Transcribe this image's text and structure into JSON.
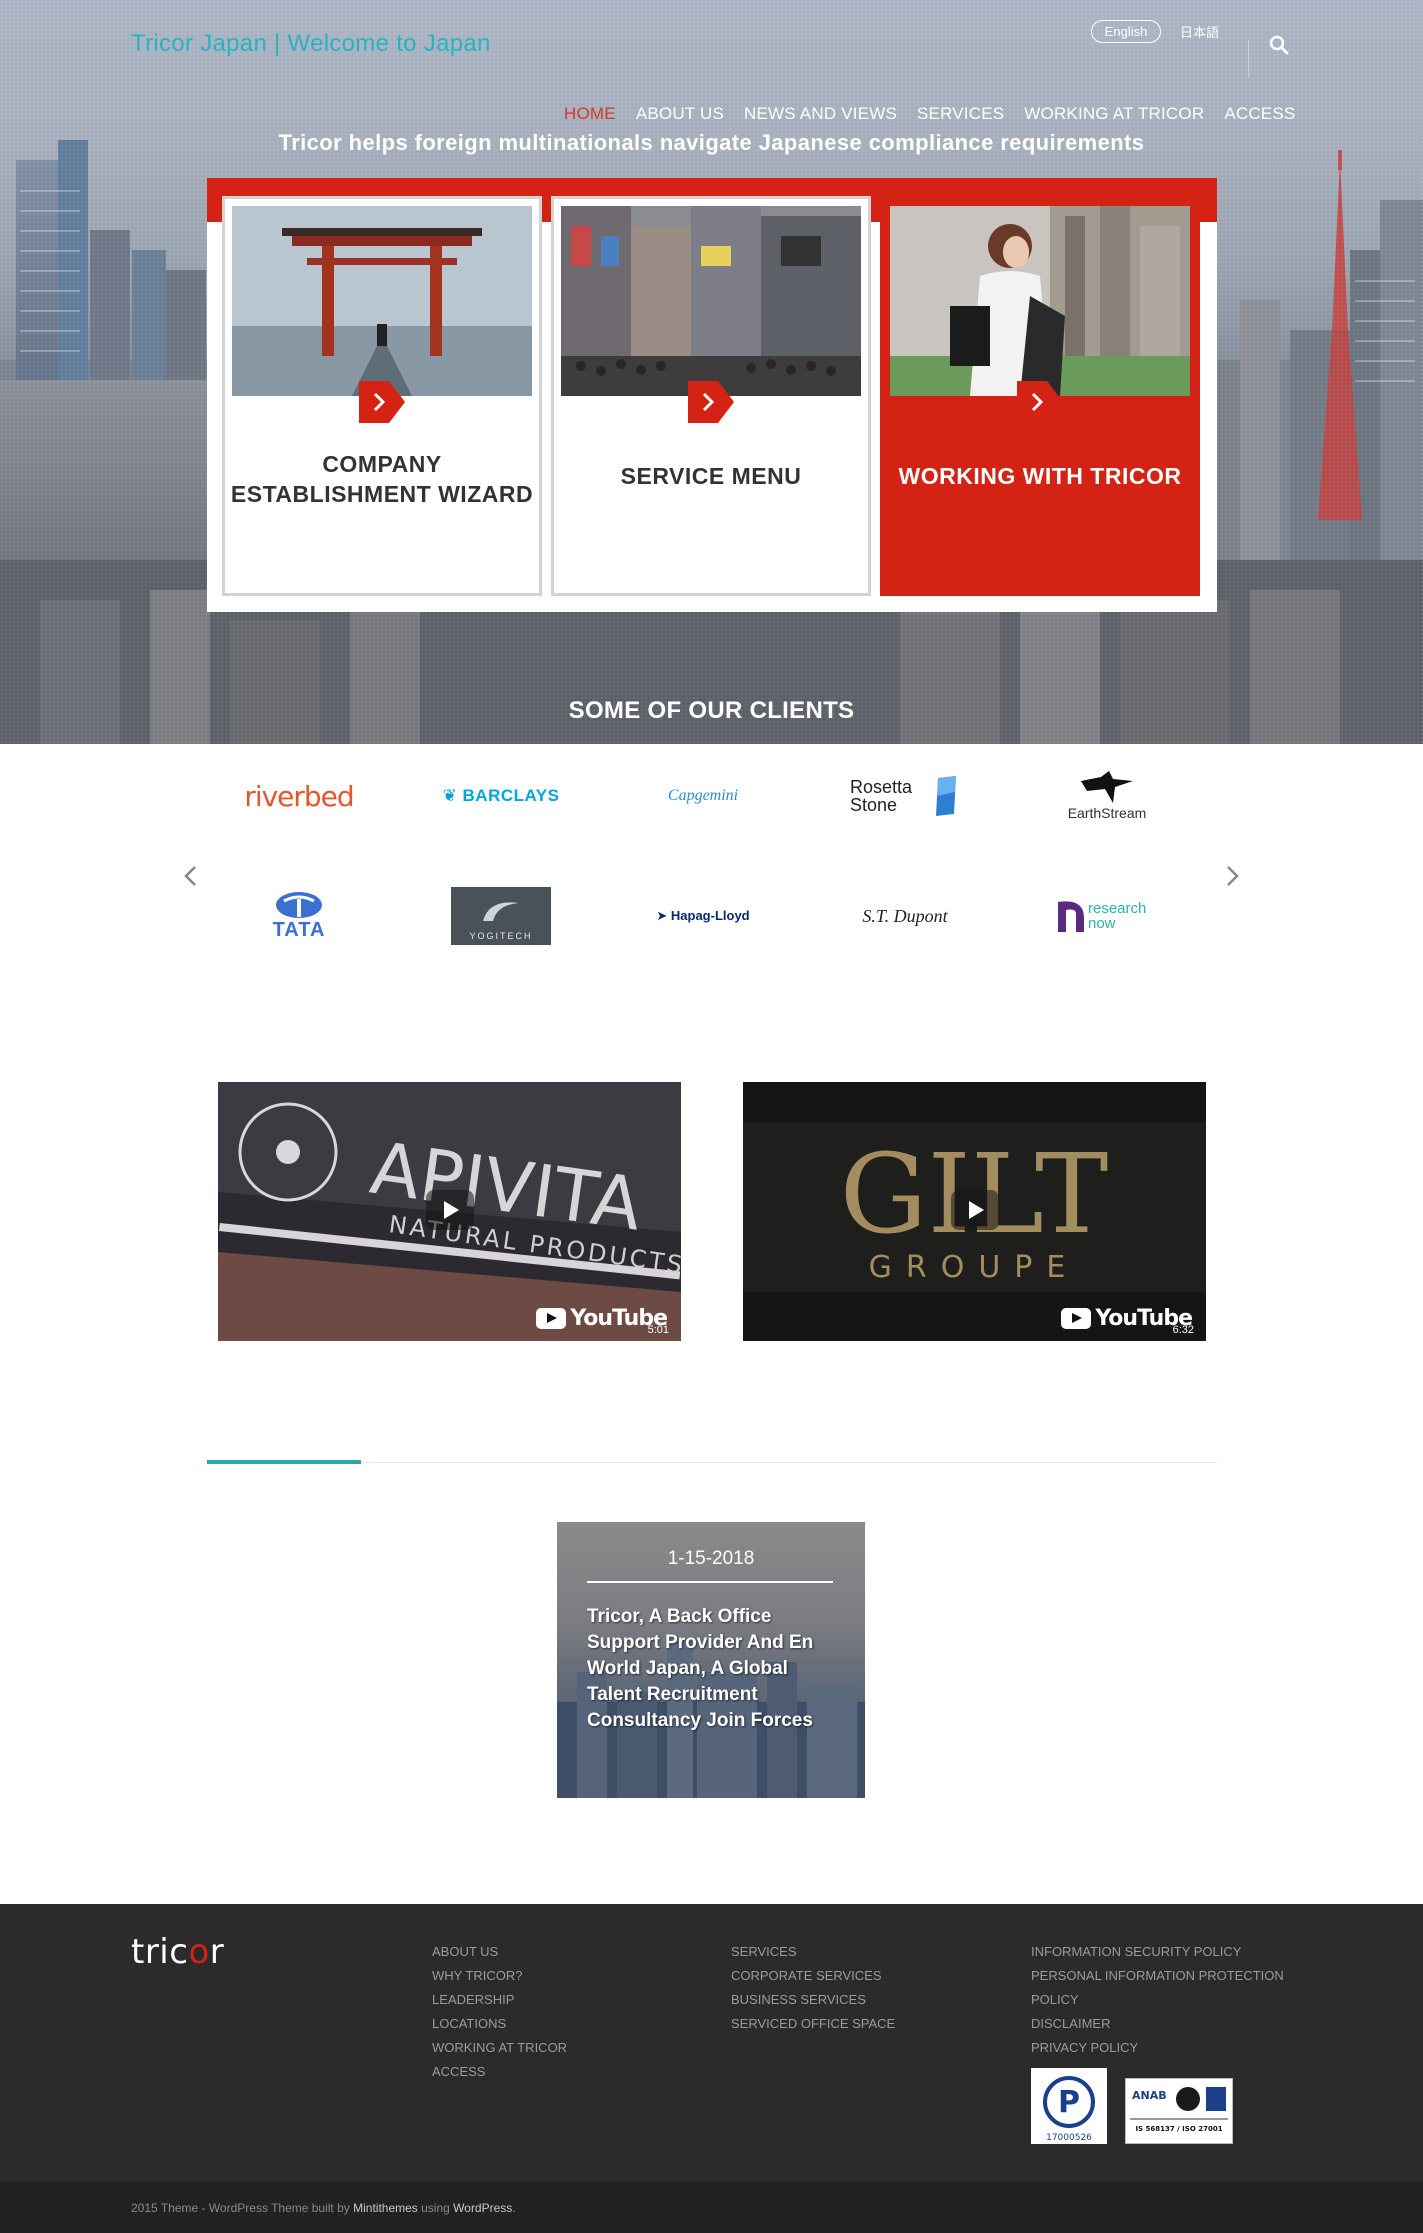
{
  "header": {
    "site_title": "Tricor Japan | Welcome to Japan",
    "lang_english": "English",
    "lang_japanese": "日本語",
    "nav": [
      {
        "label": "HOME",
        "active": true
      },
      {
        "label": "ABOUT US"
      },
      {
        "label": "NEWS AND VIEWS"
      },
      {
        "label": "SERVICES"
      },
      {
        "label": "WORKING AT TRICOR"
      },
      {
        "label": "ACCESS"
      }
    ]
  },
  "hero": {
    "tagline": "Tricor helps foreign multinationals navigate Japanese compliance requirements",
    "cards": [
      {
        "label_line1": "COMPANY",
        "label_line2": "ESTABLISHMENT WIZARD"
      },
      {
        "label_line1": "SERVICE MENU"
      },
      {
        "label_line1": "WORKING WITH TRICOR"
      }
    ],
    "clients_title": "SOME OF OUR CLIENTS"
  },
  "clients": {
    "row1": [
      "riverbed",
      "BARCLAYS",
      "Capgemini",
      "Rosetta Stone",
      "EarthStream"
    ],
    "row2": [
      "TATA",
      "YOGITECH",
      "Hapag-Lloyd",
      "S.T. Dupont",
      "research now"
    ]
  },
  "videos": [
    {
      "brand": "APIVITA",
      "sub": "NATURAL PRODUCTS",
      "duration": "5:01",
      "platform": "YouTube"
    },
    {
      "brand": "GILT",
      "sub": "GROUPE",
      "duration": "6:32",
      "platform": "YouTube"
    }
  ],
  "news": {
    "date": "1-15-2018",
    "title": "Tricor, A Back Office Support Provider And En World Japan, A Global Talent Recruitment Consultancy Join Forces"
  },
  "footer": {
    "logo_left": "tric",
    "logo_o": "o",
    "logo_right": "r",
    "col1": [
      "ABOUT US",
      "WHY TRICOR?",
      "LEADERSHIP",
      "LOCATIONS",
      "WORKING AT TRICOR",
      "ACCESS"
    ],
    "col2": [
      "SERVICES",
      "CORPORATE SERVICES",
      "BUSINESS SERVICES",
      "SERVICED OFFICE SPACE"
    ],
    "col3": [
      "INFORMATION SECURITY POLICY",
      "PERSONAL INFORMATION PROTECTION",
      "POLICY",
      "DISCLAIMER",
      "PRIVACY POLICY"
    ],
    "badge_privacy_number": "17000526",
    "badge_iso": "IS 568137 / ISO 27001",
    "badge_anab": "ANAB"
  },
  "copyright": {
    "prefix": "2015 Theme - WordPress Theme built by ",
    "author": "Mintithemes",
    "middle": " using ",
    "platform": "WordPress",
    "suffix": "."
  },
  "colors": {
    "accent_red": "#d42314",
    "teal": "#27b3c0",
    "footer_bg": "#2b2b2b"
  }
}
